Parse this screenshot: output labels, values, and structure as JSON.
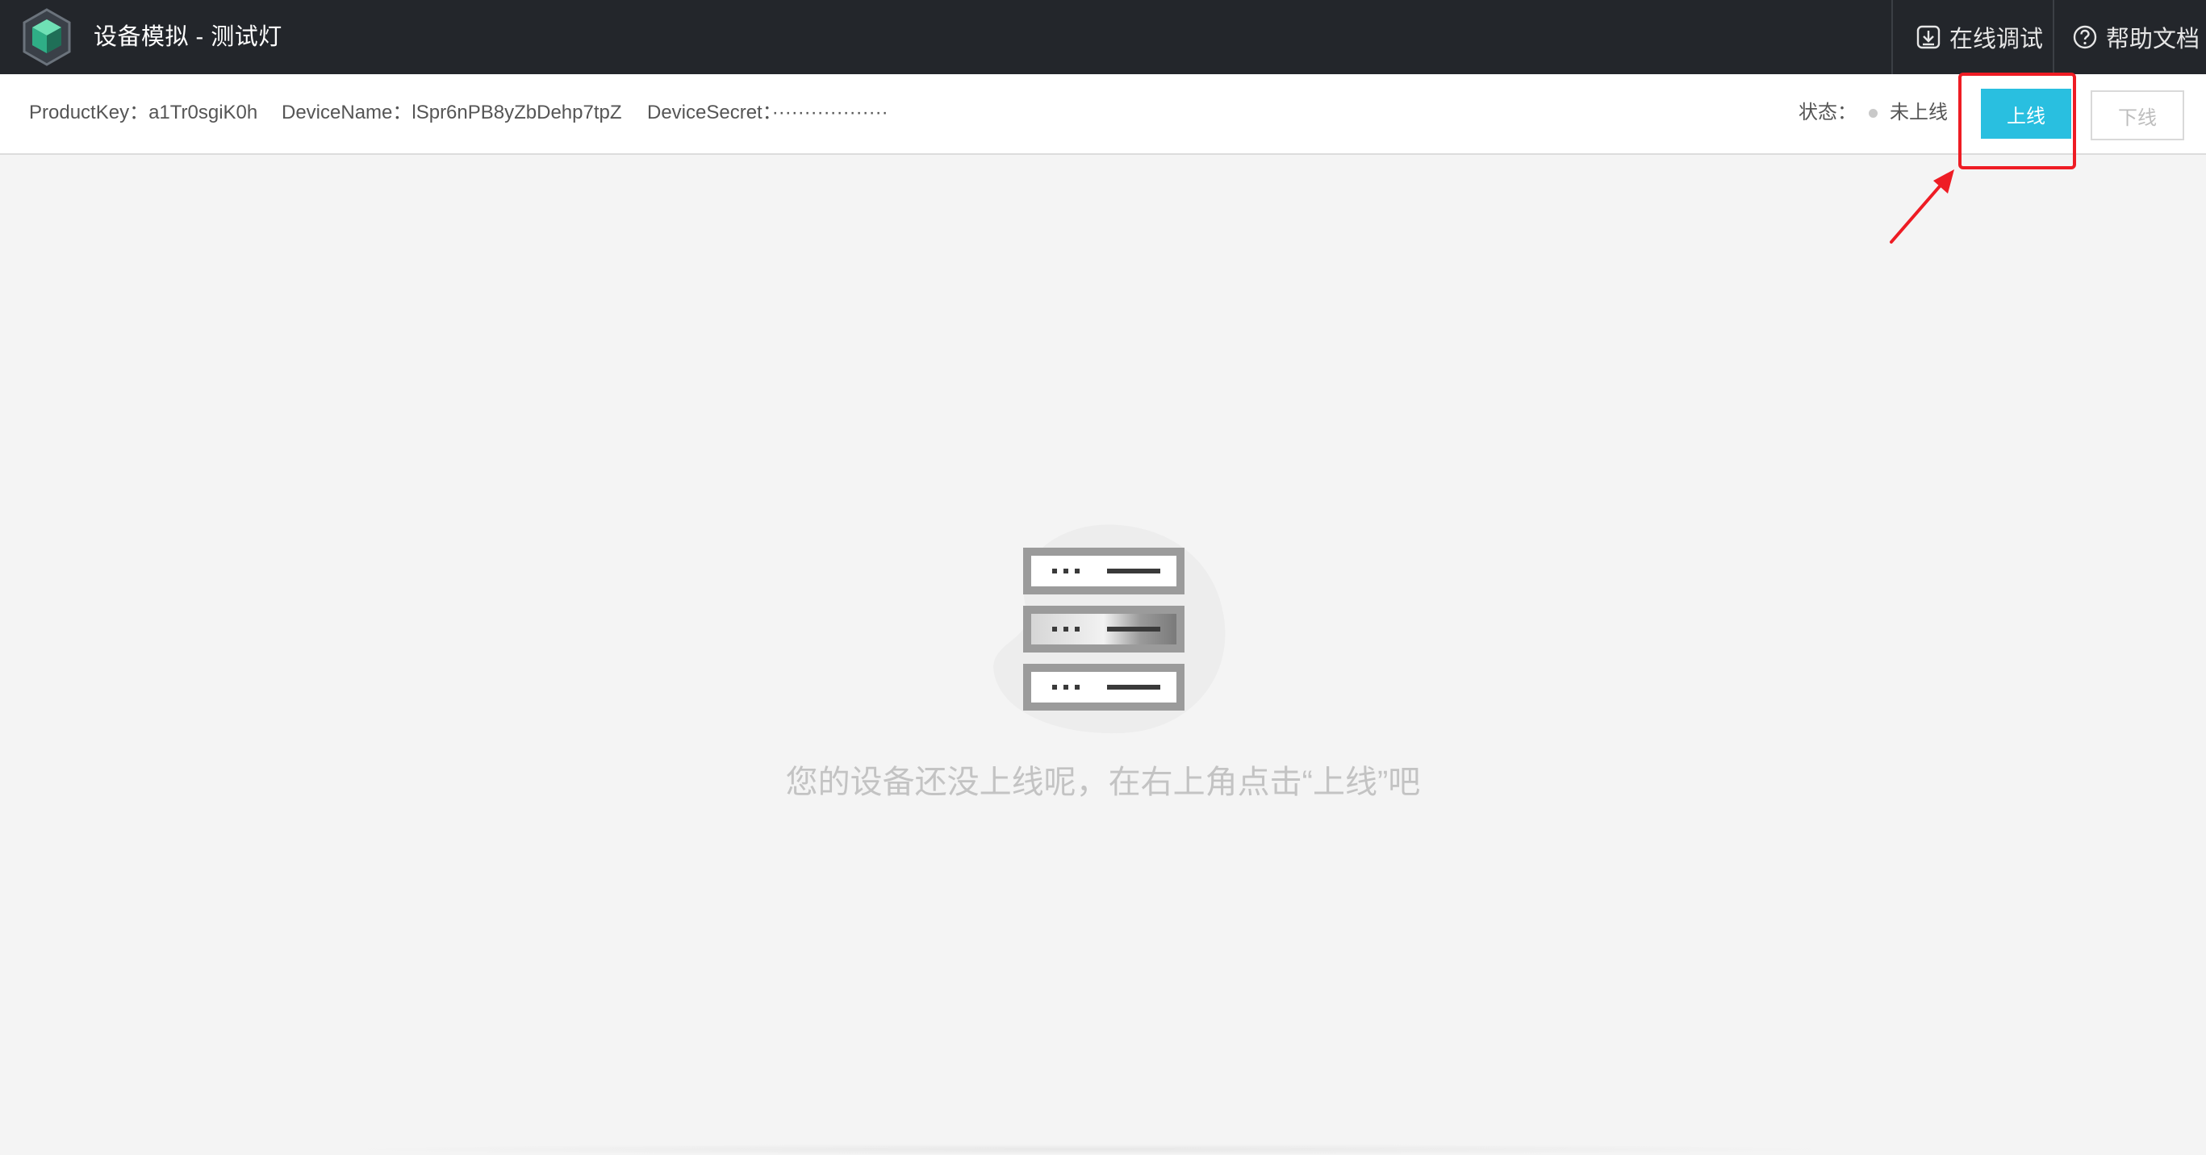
{
  "header": {
    "title": "设备模拟 - 测试灯",
    "logo_icon": "hexagon-cube-logo",
    "actions": [
      {
        "label": "在线调试",
        "icon": "download-icon"
      },
      {
        "label": "帮助文档",
        "icon": "help-circle-icon"
      }
    ]
  },
  "device_info": {
    "product_key": "ProductKey：a1Tr0sgiK0h",
    "device_name": "DeviceName：lSpr6nPB8yZbDehp7tpZ",
    "device_secret": "DeviceSecret：··················"
  },
  "status": {
    "label": "状态：",
    "value": "未上线",
    "dot_color": "#c9c9c9"
  },
  "buttons": {
    "online_label": "上线",
    "offline_label": "下线",
    "online_color": "#29bfe0"
  },
  "annotation": {
    "color": "#ee1c24"
  },
  "empty_state": {
    "icon": "server-rack-icon",
    "message": "您的设备还没上线呢，在右上角点击“上线”吧"
  }
}
